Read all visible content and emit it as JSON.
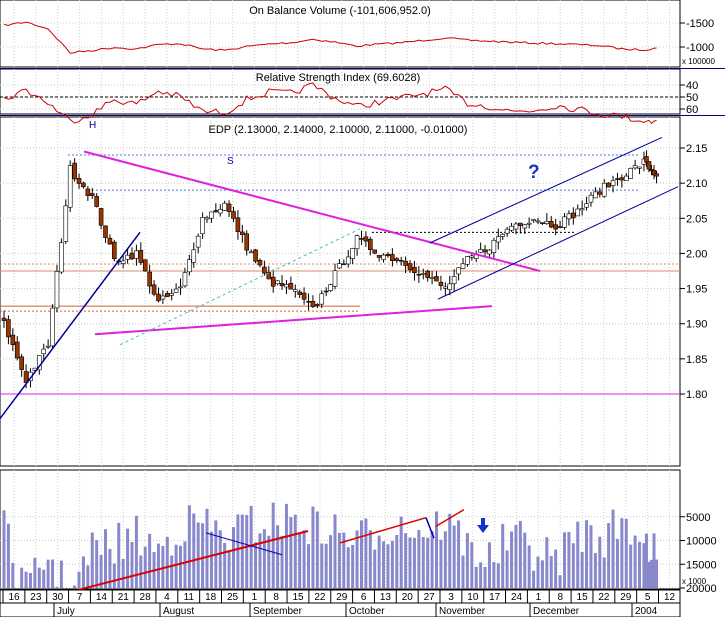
{
  "panels": {
    "obv": {
      "title": "On Balance Volume (-101,606,952.0)",
      "ticks": [
        -1000,
        -1500
      ],
      "tick_labels": [
        "-1000",
        "-1500"
      ],
      "scale_note": "x 100000",
      "line_color": "#cc0000"
    },
    "rsi": {
      "title": "Relative Strength Index (69.6028)",
      "ticks": [
        60,
        50,
        40
      ],
      "tick_labels": [
        "60",
        "50",
        "40"
      ],
      "line_color": "#cc0000"
    },
    "price": {
      "title": "EDP (2.13000, 2.14000, 2.10000, 2.11000, -0.01000)",
      "ticks": [
        2.15,
        2.1,
        2.05,
        2.0,
        1.95,
        1.9,
        1.85,
        1.8
      ],
      "tick_labels": [
        "2.15",
        "2.10",
        "2.05",
        "2.00",
        "1.95",
        "1.90",
        "1.85",
        "1.80"
      ],
      "annotations": {
        "head": "H",
        "shoulder": "S",
        "question": "?"
      },
      "up_color": "#ffffff",
      "down_color": "#993300",
      "trend_color": "#dd22dd",
      "channel_color": "#000099"
    },
    "volume": {
      "ticks": [
        20000,
        15000,
        10000,
        5000
      ],
      "tick_labels": [
        "20000",
        "15000",
        "10000",
        "5000"
      ],
      "scale_note": "x 1000",
      "bar_color": "#8888cc"
    }
  },
  "x_axis": {
    "day_labels": [
      "16",
      "23",
      "30",
      "7",
      "14",
      "21",
      "28",
      "4",
      "11",
      "18",
      "25",
      "1",
      "8",
      "15",
      "22",
      "29",
      "6",
      "13",
      "20",
      "27",
      "3",
      "10",
      "17",
      "24",
      "1",
      "8",
      "15",
      "22",
      "29",
      "5",
      "12"
    ],
    "month_labels": [
      "July",
      "August",
      "September",
      "October",
      "November",
      "December",
      "2004"
    ]
  },
  "chart_data": {
    "type": "candlestick",
    "title": "EDP (2.13000, 2.14000, 2.10000, 2.11000, -0.01000)",
    "last_close": 2.11,
    "last_open": 2.13,
    "last_high": 2.14,
    "last_low": 2.1,
    "last_change": -0.01,
    "ylim": [
      1.75,
      2.18
    ],
    "date_start": "2003-06-16",
    "date_end": "2004-01-12",
    "close_series": [
      [
        "2003-06-16",
        1.9
      ],
      [
        "2003-06-23",
        1.82
      ],
      [
        "2003-06-30",
        1.87
      ],
      [
        "2003-07-07",
        2.12
      ],
      [
        "2003-07-14",
        2.08
      ],
      [
        "2003-07-21",
        1.99
      ],
      [
        "2003-07-28",
        2.0
      ],
      [
        "2003-08-04",
        1.93
      ],
      [
        "2003-08-11",
        1.95
      ],
      [
        "2003-08-18",
        2.05
      ],
      [
        "2003-08-25",
        2.07
      ],
      [
        "2003-09-01",
        2.01
      ],
      [
        "2003-09-08",
        1.96
      ],
      [
        "2003-09-15",
        1.95
      ],
      [
        "2003-09-22",
        1.92
      ],
      [
        "2003-09-29",
        1.97
      ],
      [
        "2003-10-06",
        2.02
      ],
      [
        "2003-10-13",
        2.0
      ],
      [
        "2003-10-20",
        1.99
      ],
      [
        "2003-10-27",
        1.97
      ],
      [
        "2003-11-03",
        1.95
      ],
      [
        "2003-11-10",
        1.99
      ],
      [
        "2003-11-17",
        2.01
      ],
      [
        "2003-11-24",
        2.04
      ],
      [
        "2003-12-01",
        2.05
      ],
      [
        "2003-12-08",
        2.04
      ],
      [
        "2003-12-15",
        2.06
      ],
      [
        "2003-12-22",
        2.09
      ],
      [
        "2003-12-29",
        2.11
      ],
      [
        "2004-01-05",
        2.13
      ],
      [
        "2004-01-09",
        2.11
      ]
    ],
    "obv_ylim": [
      -1700,
      -800
    ],
    "obv_series": [
      [
        "2003-06-16",
        -1450
      ],
      [
        "2003-06-23",
        -1520
      ],
      [
        "2003-06-30",
        -1380
      ],
      [
        "2003-07-07",
        -880
      ],
      [
        "2003-07-14",
        -930
      ],
      [
        "2003-07-21",
        -990
      ],
      [
        "2003-07-28",
        -960
      ],
      [
        "2003-08-04",
        -1050
      ],
      [
        "2003-08-11",
        -1070
      ],
      [
        "2003-08-18",
        -960
      ],
      [
        "2003-08-25",
        -930
      ],
      [
        "2003-09-01",
        -1010
      ],
      [
        "2003-09-08",
        -1060
      ],
      [
        "2003-09-15",
        -1090
      ],
      [
        "2003-09-22",
        -1160
      ],
      [
        "2003-09-29",
        -1100
      ],
      [
        "2003-10-06",
        -1020
      ],
      [
        "2003-10-13",
        -1060
      ],
      [
        "2003-10-20",
        -1090
      ],
      [
        "2003-10-27",
        -1140
      ],
      [
        "2003-11-03",
        -1190
      ],
      [
        "2003-11-10",
        -1140
      ],
      [
        "2003-11-17",
        -1120
      ],
      [
        "2003-11-24",
        -1100
      ],
      [
        "2003-12-01",
        -1080
      ],
      [
        "2003-12-08",
        -1070
      ],
      [
        "2003-12-15",
        -1050
      ],
      [
        "2003-12-22",
        -1030
      ],
      [
        "2003-12-29",
        -960
      ],
      [
        "2004-01-05",
        -940
      ],
      [
        "2004-01-09",
        -980
      ]
    ],
    "rsi_ylim": [
      35,
      75
    ],
    "rsi_series": [
      [
        "2003-06-16",
        52
      ],
      [
        "2003-06-23",
        44
      ],
      [
        "2003-06-30",
        55
      ],
      [
        "2003-07-07",
        70
      ],
      [
        "2003-07-14",
        64
      ],
      [
        "2003-07-21",
        52
      ],
      [
        "2003-07-28",
        56
      ],
      [
        "2003-08-04",
        45
      ],
      [
        "2003-08-11",
        50
      ],
      [
        "2003-08-18",
        62
      ],
      [
        "2003-08-25",
        63
      ],
      [
        "2003-09-01",
        52
      ],
      [
        "2003-09-08",
        46
      ],
      [
        "2003-09-15",
        47
      ],
      [
        "2003-09-22",
        40
      ],
      [
        "2003-09-29",
        51
      ],
      [
        "2003-10-06",
        58
      ],
      [
        "2003-10-13",
        54
      ],
      [
        "2003-10-20",
        51
      ],
      [
        "2003-10-27",
        47
      ],
      [
        "2003-11-03",
        44
      ],
      [
        "2003-11-10",
        55
      ],
      [
        "2003-11-17",
        58
      ],
      [
        "2003-11-24",
        62
      ],
      [
        "2003-12-01",
        61
      ],
      [
        "2003-12-08",
        57
      ],
      [
        "2003-12-15",
        60
      ],
      [
        "2003-12-22",
        64
      ],
      [
        "2003-12-29",
        66
      ],
      [
        "2004-01-05",
        70
      ],
      [
        "2004-01-09",
        69.6
      ]
    ],
    "volume_ylim": [
      0,
      25000
    ],
    "volume_series": [
      [
        "2003-06-16",
        8000
      ],
      [
        "2003-06-23",
        21000
      ],
      [
        "2003-06-30",
        13000
      ],
      [
        "2003-07-07",
        22000
      ],
      [
        "2003-07-14",
        12000
      ],
      [
        "2003-07-21",
        11000
      ],
      [
        "2003-07-28",
        9000
      ],
      [
        "2003-08-04",
        12000
      ],
      [
        "2003-08-11",
        7000
      ],
      [
        "2003-08-18",
        6000
      ],
      [
        "2003-08-25",
        9500
      ],
      [
        "2003-09-01",
        7000
      ],
      [
        "2003-09-08",
        6000
      ],
      [
        "2003-09-15",
        5500
      ],
      [
        "2003-09-22",
        7000
      ],
      [
        "2003-09-29",
        8000
      ],
      [
        "2003-10-06",
        10000
      ],
      [
        "2003-10-13",
        7500
      ],
      [
        "2003-10-20",
        6500
      ],
      [
        "2003-10-27",
        8000
      ],
      [
        "2003-11-03",
        6000
      ],
      [
        "2003-11-10",
        11000
      ],
      [
        "2003-11-17",
        14000
      ],
      [
        "2003-11-24",
        9000
      ],
      [
        "2003-12-01",
        12000
      ],
      [
        "2003-12-08",
        14500
      ],
      [
        "2003-12-15",
        8000
      ],
      [
        "2003-12-22",
        10000
      ],
      [
        "2003-12-29",
        6000
      ],
      [
        "2004-01-05",
        9000
      ],
      [
        "2004-01-09",
        14000
      ]
    ]
  }
}
